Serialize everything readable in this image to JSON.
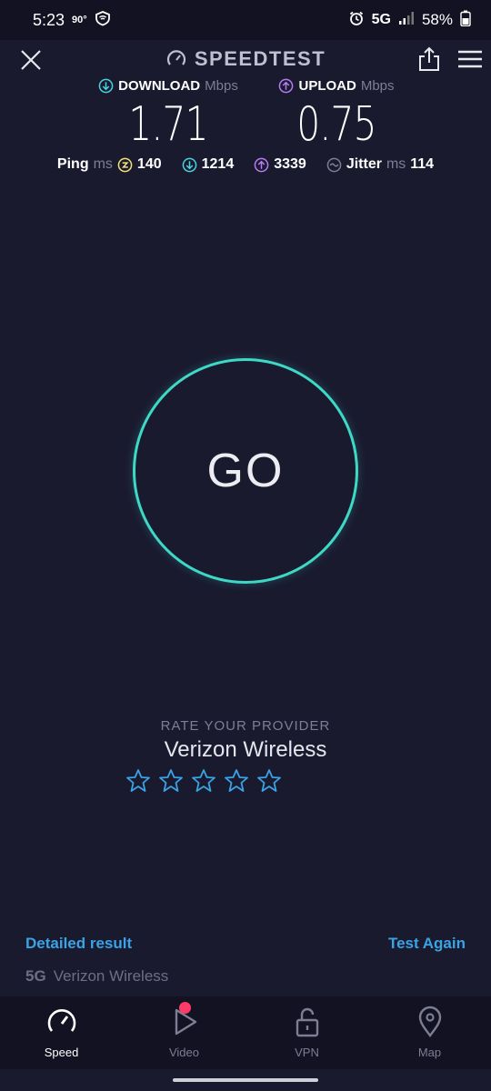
{
  "status_bar": {
    "time": "5:23",
    "temperature": "90°",
    "network": "5G",
    "battery": "58%"
  },
  "app": {
    "title": "SPEEDTEST"
  },
  "download": {
    "label": "DOWNLOAD",
    "unit": "Mbps",
    "value": "1.71"
  },
  "upload": {
    "label": "UPLOAD",
    "unit": "Mbps",
    "value": "0.75"
  },
  "stats": {
    "ping_label": "Ping",
    "ping_unit": "ms",
    "ping_idle": "140",
    "ping_download": "1214",
    "ping_upload": "3339",
    "jitter_label": "Jitter",
    "jitter_unit": "ms",
    "jitter_value": "114"
  },
  "go_label": "GO",
  "rate": {
    "label": "RATE YOUR PROVIDER",
    "provider": "Verizon Wireless",
    "rating": 0,
    "max_rating": 5
  },
  "actions": {
    "detailed": "Detailed result",
    "test_again": "Test Again"
  },
  "connection": {
    "type": "5G",
    "provider": "Verizon Wireless"
  },
  "nav": {
    "speed": "Speed",
    "video": "Video",
    "vpn": "VPN",
    "map": "Map"
  },
  "colors": {
    "background": "#1a1a2f",
    "accent_teal": "#3ed9c6",
    "download_cyan": "#49d3dd",
    "upload_purple": "#b57cf2",
    "ping_yellow": "#f3e27a",
    "link_blue": "#3aa3e6",
    "notification_red": "#ff3a66"
  }
}
